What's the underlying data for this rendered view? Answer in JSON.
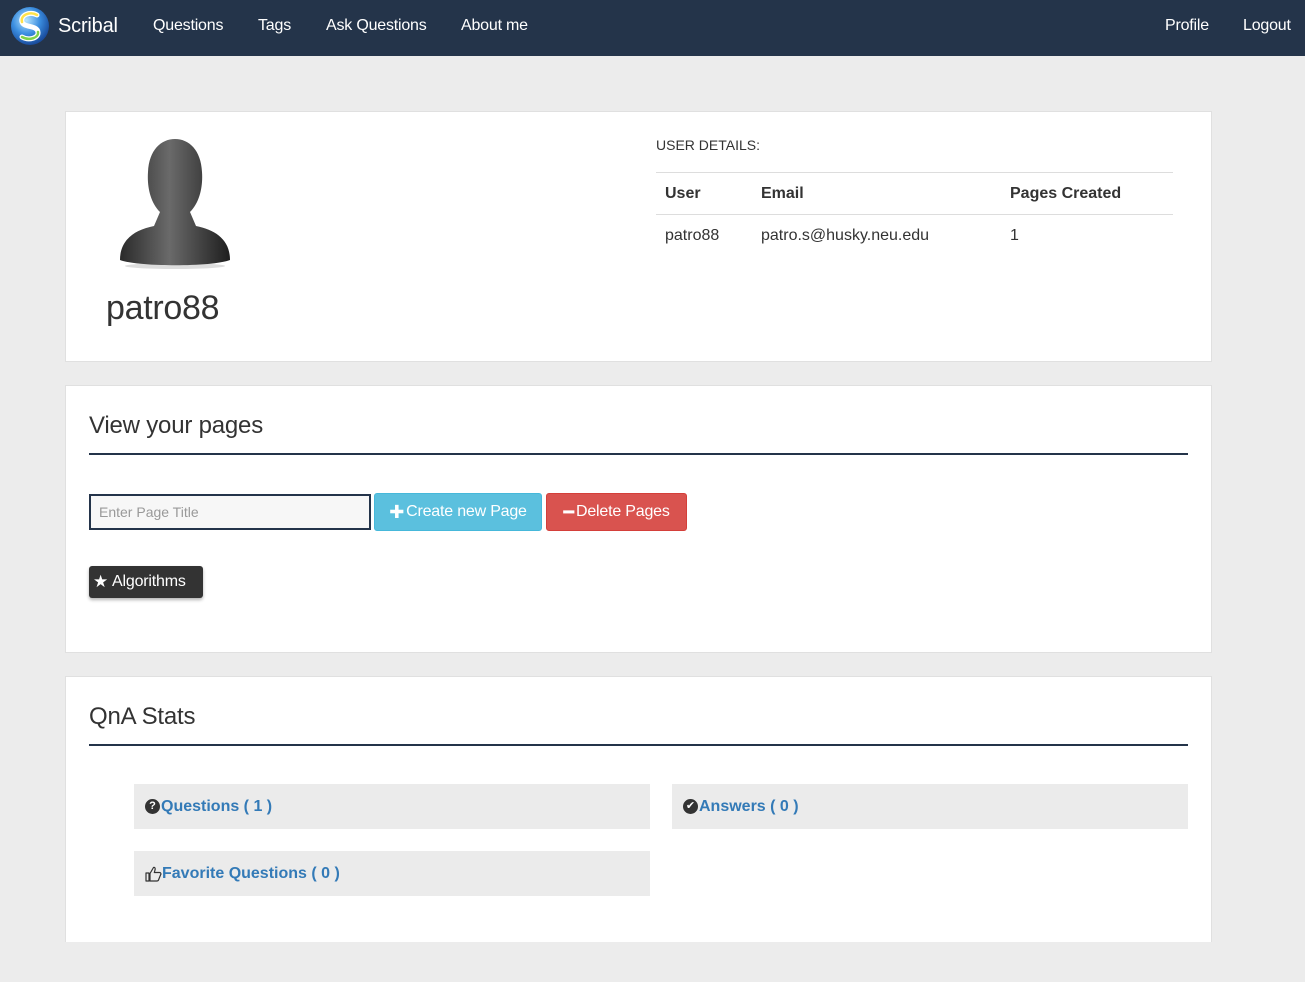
{
  "nav": {
    "brand": "Scribal",
    "links": [
      "Questions",
      "Tags",
      "Ask Questions",
      "About me"
    ],
    "right_links": [
      "Profile",
      "Logout"
    ]
  },
  "profile": {
    "username": "patro88",
    "details_label": "USER DETAILS:",
    "table": {
      "headers": [
        "User",
        "Email",
        "Pages Created"
      ],
      "rows": [
        [
          "patro88",
          "patro.s@husky.neu.edu",
          "1"
        ]
      ]
    }
  },
  "pages": {
    "title": "View your pages",
    "input_placeholder": "Enter Page Title",
    "create_label": "Create new Page",
    "delete_label": "Delete Pages",
    "tags": [
      "Algorithms"
    ]
  },
  "stats": {
    "title": "QnA Stats",
    "questions": "Questions ( 1 )",
    "answers": "Answers ( 0 )",
    "favorites": "Favorite Questions ( 0 )"
  },
  "colors": {
    "navbar": "#24344a",
    "info": "#5bc0de",
    "danger": "#d9534f",
    "link": "#337ab7"
  },
  "icons": {
    "create": "plus-icon",
    "delete": "minus-icon",
    "tag": "star-icon",
    "questions": "question-circle-icon",
    "answers": "check-circle-icon",
    "favorites": "thumbs-up-icon"
  }
}
